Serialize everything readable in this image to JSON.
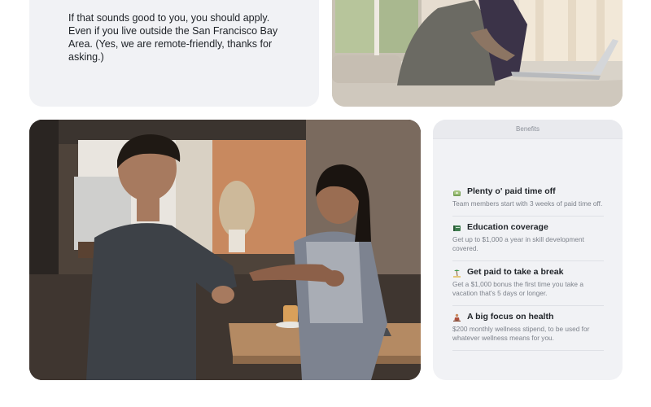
{
  "intro": {
    "text": "If that sounds good to you, you should apply. Even if you live outside the San Francisco Bay Area. (Yes, we are remote-friendly, thanks for asking.)"
  },
  "benefits": {
    "header": "Benefits",
    "items": [
      {
        "icon": "money-icon",
        "title": "Plenty o' paid time off",
        "description": "Team members start with 3 weeks of paid time off."
      },
      {
        "icon": "book-icon",
        "title": "Education coverage",
        "description": "Get up to $1,000 a year in skill development covered."
      },
      {
        "icon": "beach-icon",
        "title": "Get paid to take a break",
        "description": "Get a $1,000 bonus the first time you take a vacation that's 5 days or longer."
      },
      {
        "icon": "meditation-icon",
        "title": "A big focus on health",
        "description": "$200 monthly wellness stipend, to be used for whatever wellness means for you."
      }
    ]
  }
}
